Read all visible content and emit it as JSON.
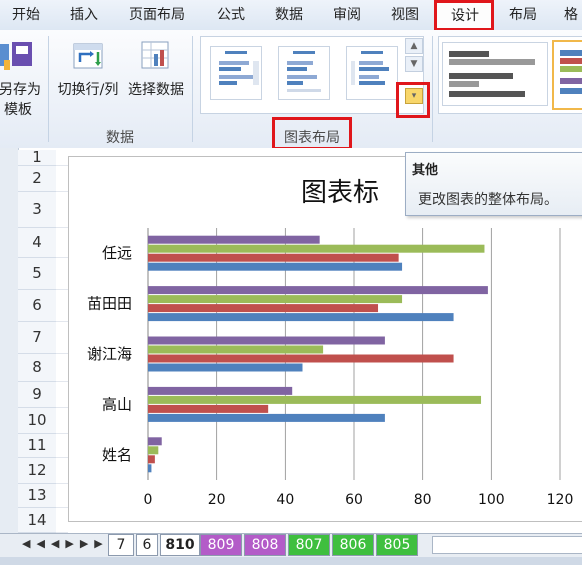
{
  "ribbon_tabs": [
    {
      "label": "开始"
    },
    {
      "label": "插入"
    },
    {
      "label": "页面布局"
    },
    {
      "label": "公式"
    },
    {
      "label": "数据"
    },
    {
      "label": "审阅"
    },
    {
      "label": "视图"
    },
    {
      "label": "设计"
    },
    {
      "label": "布局"
    },
    {
      "label": "格"
    }
  ],
  "active_tab": "设计",
  "ribbon": {
    "save_template_line1": "另存为",
    "save_template_line2": "模板",
    "switch_row_col": "切换行/列",
    "select_data": "选择数据",
    "data_group": "数据",
    "layout_group": "图表布局"
  },
  "tooltip": {
    "title": "其他",
    "body": "更改图表的整体布局。"
  },
  "row_numbers": [
    "1",
    "2",
    "3",
    "4",
    "5",
    "6",
    "7",
    "8",
    "9",
    "10",
    "11",
    "12",
    "13",
    "14"
  ],
  "sheet_tabs": [
    {
      "label": "7",
      "color": "#ffffff"
    },
    {
      "label": "6",
      "color": "#ffffff"
    },
    {
      "label": "810",
      "color": "#ffffff",
      "active": true
    },
    {
      "label": "809",
      "color": "#b35cc8"
    },
    {
      "label": "808",
      "color": "#b35cc8"
    },
    {
      "label": "807",
      "color": "#3fbf3f"
    },
    {
      "label": "806",
      "color": "#3fbf3f"
    },
    {
      "label": "805",
      "color": "#3fbf3f"
    }
  ],
  "colors": {
    "accent_red": "#e0161b",
    "series_blue": "#4f81bd",
    "series_red": "#c0504d",
    "series_green": "#9bbb59",
    "series_purple": "#8064a2"
  },
  "chart_data": {
    "type": "bar",
    "orientation": "horizontal",
    "title": "图表标",
    "categories": [
      "任远",
      "苗田田",
      "谢江海",
      "高山",
      "姓名"
    ],
    "series": [
      {
        "color": "#4f81bd",
        "values": [
          74,
          89,
          45,
          69,
          1
        ]
      },
      {
        "color": "#c0504d",
        "values": [
          73,
          67,
          89,
          35,
          2
        ]
      },
      {
        "color": "#9bbb59",
        "values": [
          98,
          74,
          51,
          97,
          3
        ]
      },
      {
        "color": "#8064a2",
        "values": [
          50,
          99,
          69,
          42,
          4
        ]
      }
    ],
    "xlim": [
      0,
      120
    ],
    "xticks": [
      "0",
      "20",
      "40",
      "60",
      "80",
      "100",
      "120"
    ],
    "grid": true
  }
}
